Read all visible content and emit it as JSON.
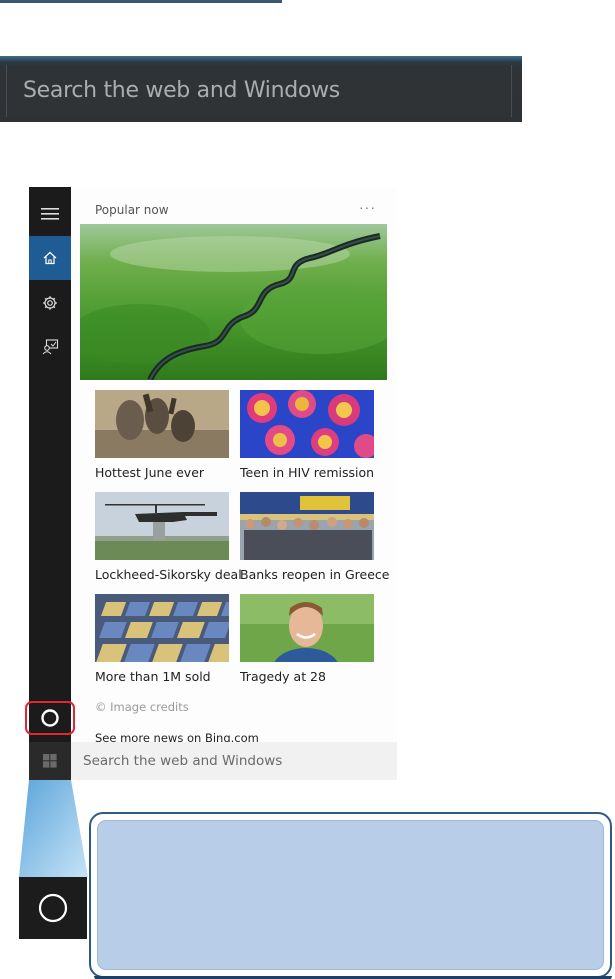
{
  "zoom": {
    "search_text": "Search the web and Windows"
  },
  "cortana": {
    "section_title": "Popular now",
    "more_label": "···",
    "sidebar_icons": [
      "hamburger-menu-icon",
      "home-icon",
      "settings-gear-icon",
      "feedback-icon"
    ],
    "news": [
      {
        "caption": "Hottest June ever"
      },
      {
        "caption": "Teen in HIV remission"
      },
      {
        "caption": "Lockheed-Sikorsky deal"
      },
      {
        "caption": "Banks reopen in Greece"
      },
      {
        "caption": "More than 1M sold"
      },
      {
        "caption": "Tragedy at 28"
      }
    ],
    "credits": "© Image credits",
    "see_more": "See more news on Bing.com",
    "search_placeholder": "Search the web and Windows"
  },
  "colors": {
    "accent": "#1f5c93",
    "sidebar": "#1b1b1b",
    "highlight": "#e0282e",
    "callout_fill": "#b8cde8",
    "callout_border": "#2e5a88"
  }
}
